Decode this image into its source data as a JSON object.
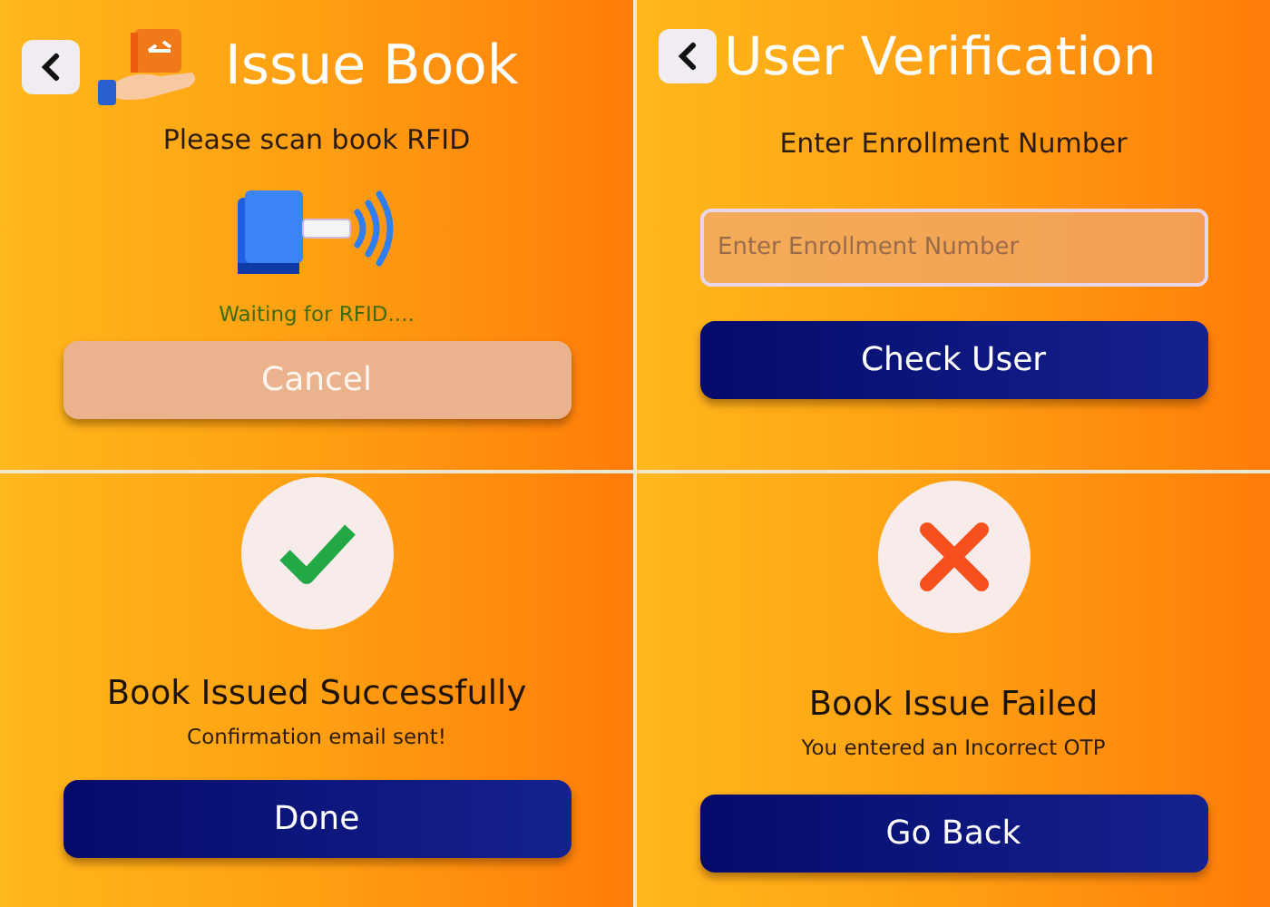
{
  "panels": [
    {
      "kind": "scan",
      "title": "Issue Book",
      "prompt": "Please scan book RFID",
      "status": "Waiting for RFID....",
      "button": {
        "label": "Cancel",
        "disabled": true
      }
    },
    {
      "kind": "form",
      "title": "User Verification",
      "prompt": "Enter Enrollment Number",
      "field": {
        "placeholder": "Enter Enrollment Number"
      },
      "button": {
        "label": "Check User",
        "disabled": false
      }
    },
    {
      "kind": "success",
      "message": "Book Issued Successfully",
      "detail": "Confirmation email sent!",
      "button": {
        "label": "Done",
        "disabled": false
      }
    },
    {
      "kind": "failure",
      "message": "Book Issue Failed",
      "detail": "You entered an Incorrect OTP",
      "button": {
        "label": "Go Back",
        "disabled": false
      }
    }
  ]
}
